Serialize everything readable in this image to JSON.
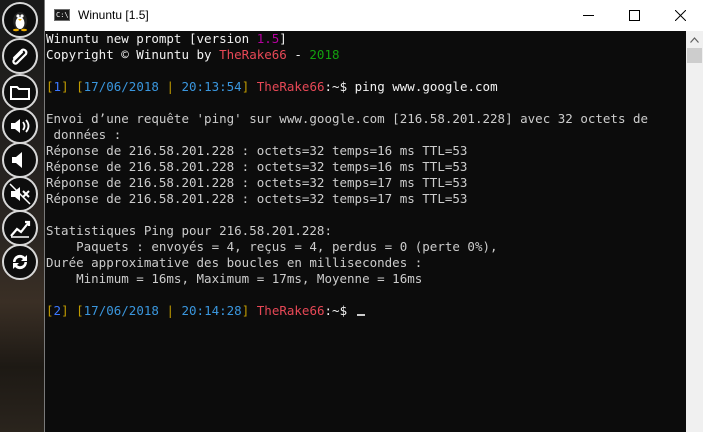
{
  "window": {
    "title": "Winuntu [1.5]",
    "app_icon_text": "C:\\"
  },
  "dock": {
    "icons": [
      "linux-tux-icon",
      "paperclip-icon",
      "folder-icon",
      "volume-up-icon",
      "volume-down-icon",
      "volume-mute-icon",
      "chart-icon",
      "refresh-icon"
    ]
  },
  "console": {
    "banner": {
      "line1_prefix": "Winuntu new prompt [version ",
      "version": "1.5",
      "line1_suffix": "]",
      "line2_prefix": "Copyright © Winuntu by ",
      "author": "TheRake66",
      "line2_sep": " - ",
      "year": "2018"
    },
    "prompt1": {
      "index": "1",
      "date": "17/06/2018",
      "time": "20:13:54",
      "user": "TheRake66",
      "path": ":~$",
      "command": " ping www.google.com"
    },
    "output": [
      "Envoi d’une requête 'ping' sur www.google.com [216.58.201.228] avec 32 octets de",
      " données :",
      "Réponse de 216.58.201.228 : octets=32 temps=16 ms TTL=53",
      "Réponse de 216.58.201.228 : octets=32 temps=16 ms TTL=53",
      "Réponse de 216.58.201.228 : octets=32 temps=17 ms TTL=53",
      "Réponse de 216.58.201.228 : octets=32 temps=17 ms TTL=53"
    ],
    "stats": [
      "Statistiques Ping pour 216.58.201.228:",
      "    Paquets : envoyés = 4, reçus = 4, perdus = 0 (perte 0%),",
      "Durée approximative des boucles en millisecondes :",
      "    Minimum = 16ms, Maximum = 17ms, Moyenne = 16ms"
    ],
    "prompt2": {
      "index": "2",
      "date": "17/06/2018",
      "time": "20:14:28",
      "user": "TheRake66",
      "path": ":~$",
      "command": " "
    }
  }
}
